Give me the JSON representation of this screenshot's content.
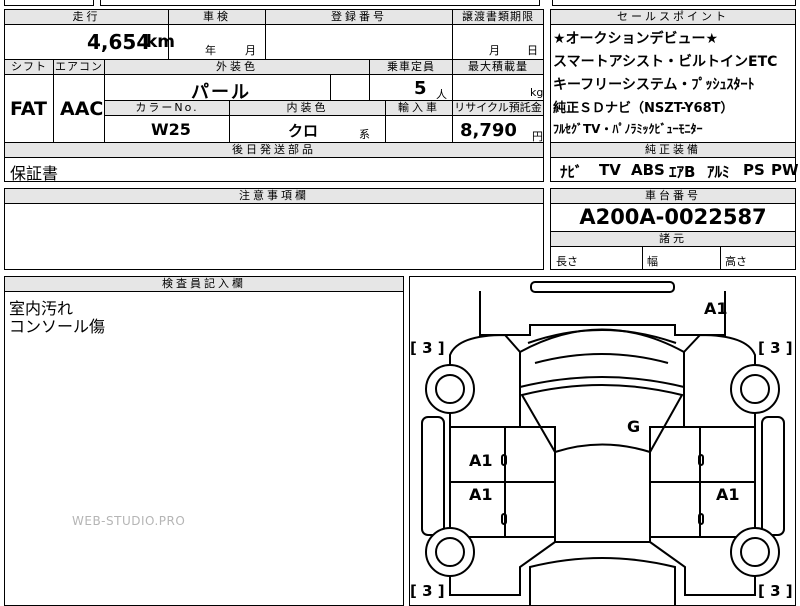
{
  "left_top": {
    "mileage": {
      "label": "走行",
      "value": "4,654",
      "unit": "km"
    },
    "inspection": {
      "label": "車検",
      "year_unit": "年",
      "month_unit": "月"
    },
    "registration": {
      "label": "登録番号"
    },
    "transfer_deadline": {
      "label": "譲渡書類期限",
      "month_unit": "月",
      "day_unit": "日"
    },
    "shift": {
      "label": "シフト",
      "value": "FAT"
    },
    "aircon": {
      "label": "エアコン",
      "value": "AAC"
    },
    "exterior_color": {
      "label": "外装色",
      "value": "パール"
    },
    "capacity": {
      "label": "乗車定員",
      "value": "5",
      "unit": "人"
    },
    "max_load": {
      "label": "最大積載量",
      "unit": "kg"
    },
    "color_no": {
      "label": "カラーNo.",
      "value": "W25"
    },
    "interior_color": {
      "label": "内装色",
      "value": "クロ",
      "suffix": "系"
    },
    "import": {
      "label": "輸入車"
    },
    "recycle": {
      "label": "リサイクル預託金",
      "value": "8,790",
      "unit": "円"
    },
    "later_parts": {
      "label": "後日発送部品",
      "value": "保証書"
    },
    "notes": {
      "label": "注意事項欄"
    }
  },
  "sales_points": {
    "label": "セールスポイント",
    "lines": [
      "★オークションデビュー★",
      "スマートアシスト・ビルトインETC",
      "キーフリーシステム・ﾌﾟｯｼｭｽﾀｰﾄ",
      "純正ＳＤナビ（NSZT-Y68T）",
      "ﾌﾙｾｸﾞTV・ﾊﾟﾉﾗﾐｯｸﾋﾞｭｰﾓﾆﾀｰ"
    ]
  },
  "equipment": {
    "label": "純正装備",
    "items": [
      "ﾅﾋﾞ",
      "TV",
      "ABS",
      "ｴｱB",
      "ｱﾙﾐ",
      "PS",
      "PW"
    ]
  },
  "chassis": {
    "label": "車台番号",
    "value": "A200A-0022587"
  },
  "dimensions": {
    "label": "諸元",
    "length": "長さ",
    "width": "幅",
    "height": "高さ"
  },
  "inspector": {
    "label": "検査員記入欄",
    "lines": [
      "室内汚れ",
      "コンソール傷"
    ]
  },
  "diagram_marks": {
    "a1_front_right": "A1",
    "g_roof": "G",
    "a1_left_upper": "A1",
    "a1_left_lower": "A1",
    "a1_right_lower": "A1",
    "tire_fl": "[ 3 ]",
    "tire_fr": "[ 3 ]",
    "tire_rl": "[ 3 ]",
    "tire_rr": "[ 3 ]"
  },
  "watermark": "WEB-STUDIO.PRO"
}
